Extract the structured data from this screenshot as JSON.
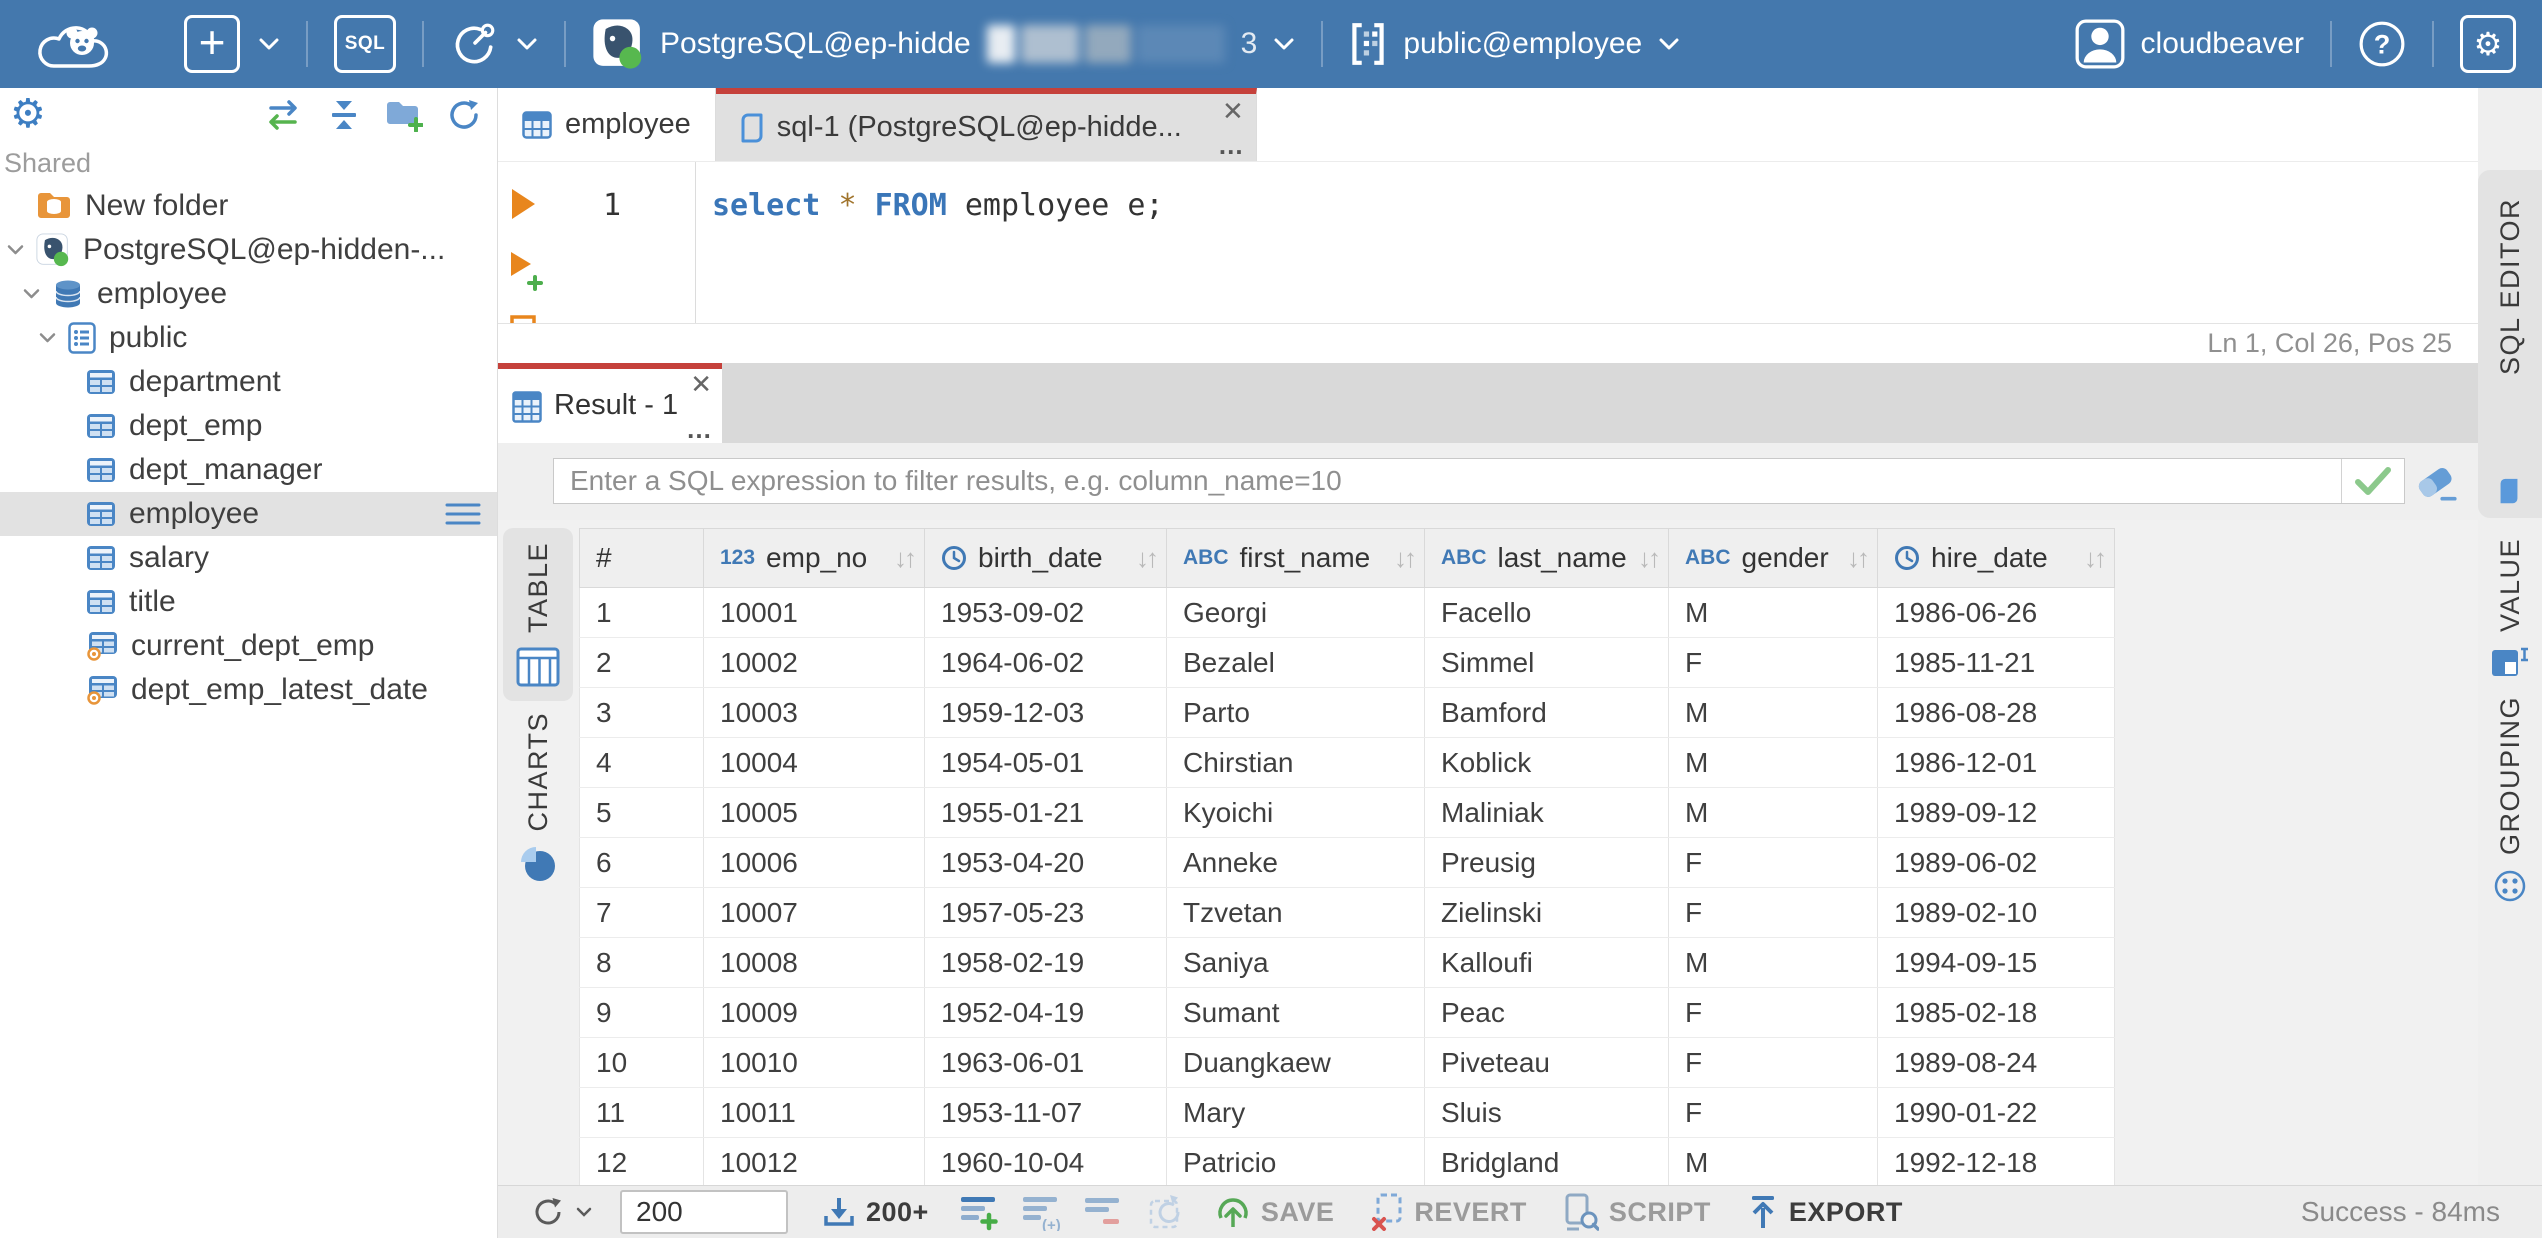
{
  "topbar": {
    "user_name": "cloudbeaver",
    "connection": {
      "label": "PostgreSQL@ep-hidde",
      "suffix": "3"
    },
    "schema_selector": "public@employee",
    "buttons": {
      "sql_label": "SQL"
    }
  },
  "sidebar": {
    "section_label": "Shared",
    "tree": [
      {
        "label": "New folder",
        "type": "folder-db",
        "depth": 1,
        "chevron": false
      },
      {
        "label": "PostgreSQL@ep-hidden-...",
        "type": "postgres",
        "depth": 0,
        "chevron": true
      },
      {
        "label": "employee",
        "type": "database",
        "depth": 1,
        "chevron": true
      },
      {
        "label": "public",
        "type": "schema",
        "depth": 2,
        "chevron": true
      },
      {
        "label": "department",
        "type": "table",
        "depth": 3,
        "chevron": false
      },
      {
        "label": "dept_emp",
        "type": "table",
        "depth": 3,
        "chevron": false
      },
      {
        "label": "dept_manager",
        "type": "table",
        "depth": 3,
        "chevron": false
      },
      {
        "label": "employee",
        "type": "table",
        "depth": 3,
        "chevron": false,
        "selected": true
      },
      {
        "label": "salary",
        "type": "table",
        "depth": 3,
        "chevron": false
      },
      {
        "label": "title",
        "type": "table",
        "depth": 3,
        "chevron": false
      },
      {
        "label": "current_dept_emp",
        "type": "view",
        "depth": 3,
        "chevron": false
      },
      {
        "label": "dept_emp_latest_date",
        "type": "view",
        "depth": 3,
        "chevron": false
      }
    ]
  },
  "editor": {
    "tabs": [
      {
        "label": "employee"
      },
      {
        "label": "sql-1 (PostgreSQL@ep-hidde..."
      }
    ],
    "line_number": "1",
    "code": {
      "kw_select": "select",
      "star": "*",
      "kw_from": "FROM",
      "rest": "employee e;"
    },
    "status_line": "Ln 1, Col 26, Pos 25",
    "side_tab": "SQL EDITOR"
  },
  "results": {
    "tab_label": "Result - 1",
    "filter_placeholder": "Enter a SQL expression to filter results, e.g. column_name=10",
    "left_tabs": [
      "TABLE",
      "CHARTS"
    ],
    "right_tabs": [
      "VALUE",
      "GROUPING"
    ],
    "grid": {
      "columns": [
        {
          "label": "#",
          "type": "index"
        },
        {
          "label": "emp_no",
          "type": "number"
        },
        {
          "label": "birth_date",
          "type": "date"
        },
        {
          "label": "first_name",
          "type": "string"
        },
        {
          "label": "last_name",
          "type": "string"
        },
        {
          "label": "gender",
          "type": "string"
        },
        {
          "label": "hire_date",
          "type": "date"
        }
      ],
      "rows": [
        [
          "1",
          "10001",
          "1953-09-02",
          "Georgi",
          "Facello",
          "M",
          "1986-06-26"
        ],
        [
          "2",
          "10002",
          "1964-06-02",
          "Bezalel",
          "Simmel",
          "F",
          "1985-11-21"
        ],
        [
          "3",
          "10003",
          "1959-12-03",
          "Parto",
          "Bamford",
          "M",
          "1986-08-28"
        ],
        [
          "4",
          "10004",
          "1954-05-01",
          "Chirstian",
          "Koblick",
          "M",
          "1986-12-01"
        ],
        [
          "5",
          "10005",
          "1955-01-21",
          "Kyoichi",
          "Maliniak",
          "M",
          "1989-09-12"
        ],
        [
          "6",
          "10006",
          "1953-04-20",
          "Anneke",
          "Preusig",
          "F",
          "1989-06-02"
        ],
        [
          "7",
          "10007",
          "1957-05-23",
          "Tzvetan",
          "Zielinski",
          "F",
          "1989-02-10"
        ],
        [
          "8",
          "10008",
          "1958-02-19",
          "Saniya",
          "Kalloufi",
          "M",
          "1994-09-15"
        ],
        [
          "9",
          "10009",
          "1952-04-19",
          "Sumant",
          "Peac",
          "F",
          "1985-02-18"
        ],
        [
          "10",
          "10010",
          "1963-06-01",
          "Duangkaew",
          "Piveteau",
          "F",
          "1989-08-24"
        ],
        [
          "11",
          "10011",
          "1953-11-07",
          "Mary",
          "Sluis",
          "F",
          "1990-01-22"
        ],
        [
          "12",
          "10012",
          "1960-10-04",
          "Patricio",
          "Bridgland",
          "M",
          "1992-12-18"
        ]
      ]
    },
    "toolbar": {
      "row_limit": "200",
      "fetch_label": "200+",
      "save_label": "SAVE",
      "revert_label": "REVERT",
      "script_label": "SCRIPT",
      "export_label": "EXPORT",
      "status_text": "Success - 84ms"
    }
  },
  "colors": {
    "topbar_blue": "#4478ad",
    "accent_red": "#c5413b",
    "icon_blue": "#4079b5",
    "success_green": "#56a856",
    "selection_gray": "#e2e2e2"
  }
}
